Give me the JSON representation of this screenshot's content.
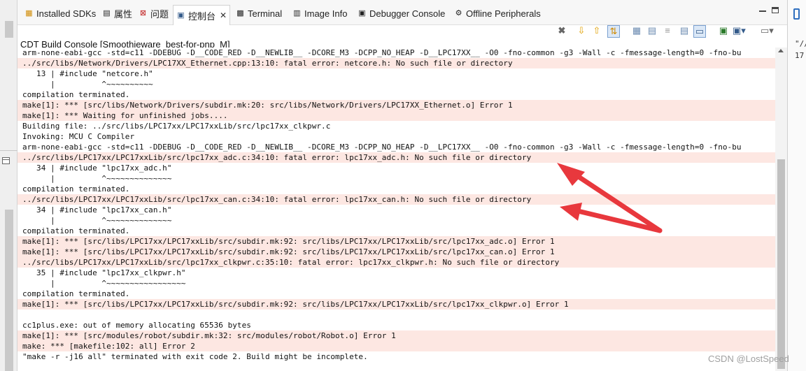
{
  "tabs": [
    {
      "label": "Installed SDKs",
      "icon": "sdk-icon",
      "icon_glyph": "▦",
      "icon_color": "#d08a00"
    },
    {
      "label": "属性",
      "icon": "properties-icon",
      "icon_glyph": "▤",
      "icon_color": "#555555"
    },
    {
      "label": "问题",
      "icon": "problems-icon",
      "icon_glyph": "⊠",
      "icon_color": "#c02020"
    },
    {
      "label": "控制台",
      "icon": "console-icon",
      "icon_glyph": "▣",
      "icon_color": "#335a8a",
      "close": "✕"
    },
    {
      "label": "Terminal",
      "icon": "terminal-icon",
      "icon_glyph": "▩",
      "icon_color": "#333333"
    },
    {
      "label": "Image Info",
      "icon": "image-info-icon",
      "icon_glyph": "▥",
      "icon_color": "#555555"
    },
    {
      "label": "Debugger Console",
      "icon": "debugger-console-icon",
      "icon_glyph": "▣",
      "icon_color": "#444444"
    },
    {
      "label": "Offline Peripherals",
      "icon": "offline-peripherals-icon",
      "icon_glyph": "⚙",
      "icon_color": "#666666"
    }
  ],
  "console_title": "CDT Build Console [Smoothieware_best-for-pnp_M]",
  "console_lines": [
    {
      "text": "arm-none-eabi-gcc -std=c11 -DDEBUG -D__CODE_RED -D__NEWLIB__ -DCORE_M3 -DCPP_NO_HEAP -D__LPC17XX__ -O0 -fno-common -g3 -Wall -c -fmessage-length=0 -fno-bu",
      "err": false
    },
    {
      "text": "../src/libs/Network/Drivers/LPC17XX_Ethernet.cpp:13:10: fatal error: netcore.h: No such file or directory",
      "err": true
    },
    {
      "text": "   13 | #include \"netcore.h\"",
      "err": false
    },
    {
      "text": "      |          ^~~~~~~~~~~",
      "err": false
    },
    {
      "text": "compilation terminated.",
      "err": false
    },
    {
      "text": "make[1]: *** [src/libs/Network/Drivers/subdir.mk:20: src/libs/Network/Drivers/LPC17XX_Ethernet.o] Error 1",
      "err": true
    },
    {
      "text": "make[1]: *** Waiting for unfinished jobs....",
      "err": true
    },
    {
      "text": "Building file: ../src/libs/LPC17xx/LPC17xxLib/src/lpc17xx_clkpwr.c",
      "err": false
    },
    {
      "text": "Invoking: MCU C Compiler",
      "err": false
    },
    {
      "text": "arm-none-eabi-gcc -std=c11 -DDEBUG -D__CODE_RED -D__NEWLIB__ -DCORE_M3 -DCPP_NO_HEAP -D__LPC17XX__ -O0 -fno-common -g3 -Wall -c -fmessage-length=0 -fno-bu",
      "err": false
    },
    {
      "text": "../src/libs/LPC17xx/LPC17xxLib/src/lpc17xx_adc.c:34:10: fatal error: lpc17xx_adc.h: No such file or directory",
      "err": true
    },
    {
      "text": "   34 | #include \"lpc17xx_adc.h\"",
      "err": false
    },
    {
      "text": "      |          ^~~~~~~~~~~~~~~",
      "err": false
    },
    {
      "text": "compilation terminated.",
      "err": false
    },
    {
      "text": "../src/libs/LPC17xx/LPC17xxLib/src/lpc17xx_can.c:34:10: fatal error: lpc17xx_can.h: No such file or directory",
      "err": true
    },
    {
      "text": "   34 | #include \"lpc17xx_can.h\"",
      "err": false
    },
    {
      "text": "      |          ^~~~~~~~~~~~~~~",
      "err": false
    },
    {
      "text": "compilation terminated.",
      "err": false
    },
    {
      "text": "make[1]: *** [src/libs/LPC17xx/LPC17xxLib/src/subdir.mk:92: src/libs/LPC17xx/LPC17xxLib/src/lpc17xx_adc.o] Error 1",
      "err": true
    },
    {
      "text": "make[1]: *** [src/libs/LPC17xx/LPC17xxLib/src/subdir.mk:92: src/libs/LPC17xx/LPC17xxLib/src/lpc17xx_can.o] Error 1",
      "err": true
    },
    {
      "text": "../src/libs/LPC17xx/LPC17xxLib/src/lpc17xx_clkpwr.c:35:10: fatal error: lpc17xx_clkpwr.h: No such file or directory",
      "err": true
    },
    {
      "text": "   35 | #include \"lpc17xx_clkpwr.h\"",
      "err": false
    },
    {
      "text": "      |          ^~~~~~~~~~~~~~~~~~",
      "err": false
    },
    {
      "text": "compilation terminated.",
      "err": false
    },
    {
      "text": "make[1]: *** [src/libs/LPC17xx/LPC17xxLib/src/subdir.mk:92: src/libs/LPC17xx/LPC17xxLib/src/lpc17xx_clkpwr.o] Error 1",
      "err": true
    },
    {
      "text": "",
      "err": false
    },
    {
      "text": "cc1plus.exe: out of memory allocating 65536 bytes",
      "err": false
    },
    {
      "text": "make[1]: *** [src/modules/robot/subdir.mk:32: src/modules/robot/Robot.o] Error 1",
      "err": true
    },
    {
      "text": "make: *** [makefile:102: all] Error 2",
      "err": true
    },
    {
      "text": "\"make -r -j16 all\" terminated with exit code 2. Build might be incomplete.",
      "err": false
    }
  ],
  "toolbar_icons": [
    "clear-console-icon",
    "next-error-icon",
    "previous-error-icon",
    "scroll-lock-icon",
    "word-wrap-icon",
    "pin-console-icon",
    "show-console-icon",
    "display-selected-console-icon",
    "open-console-icon",
    "new-console-icon",
    "new-console-dropdown-icon",
    "view-menu-icon"
  ],
  "right_panel": {
    "line1": "\"//",
    "line2": "17"
  },
  "watermark": "CSDN @LostSpeed",
  "colors": {
    "error_background": "#fde7e2",
    "arrow": "#e8383d",
    "active_tab_border": "#d2d2d2"
  }
}
